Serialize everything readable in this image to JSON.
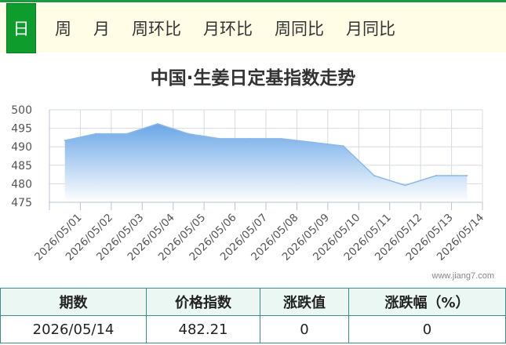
{
  "tabs": [
    {
      "label": "日",
      "active": true
    },
    {
      "label": "周",
      "active": false
    },
    {
      "label": "月",
      "active": false
    },
    {
      "label": "周环比",
      "active": false
    },
    {
      "label": "月环比",
      "active": false
    },
    {
      "label": "周同比",
      "active": false
    },
    {
      "label": "月同比",
      "active": false
    }
  ],
  "chart_data": {
    "type": "area",
    "title": "中国·生姜日定基指数走势",
    "categories": [
      "2026/05/01",
      "2026/05/02",
      "2026/05/03",
      "2026/05/04",
      "2026/05/05",
      "2026/05/06",
      "2026/05/07",
      "2026/05/08",
      "2026/05/09",
      "2026/05/10",
      "2026/05/11",
      "2026/05/12",
      "2026/05/13",
      "2026/05/14"
    ],
    "values": [
      491.7,
      493.5,
      493.5,
      496.2,
      493.5,
      492.2,
      492.2,
      492.2,
      491.2,
      490.2,
      482.2,
      479.6,
      482.2,
      482.21
    ],
    "yticks": [
      475,
      480,
      485,
      490,
      495,
      500
    ],
    "ylim": [
      475,
      500
    ],
    "grid": true,
    "colors": {
      "line": "#8ab8ea",
      "fill_top": "#6aa6e6",
      "fill_bottom": "#ffffff",
      "grid": "#d5dbe3",
      "axis": "#b8c4d0"
    }
  },
  "watermark": "www.jiang7.com",
  "table": {
    "headers": [
      "期数",
      "价格指数",
      "涨跌值",
      "涨跌幅（%）"
    ],
    "row": [
      "2026/05/14",
      "482.21",
      "0",
      "0"
    ]
  }
}
